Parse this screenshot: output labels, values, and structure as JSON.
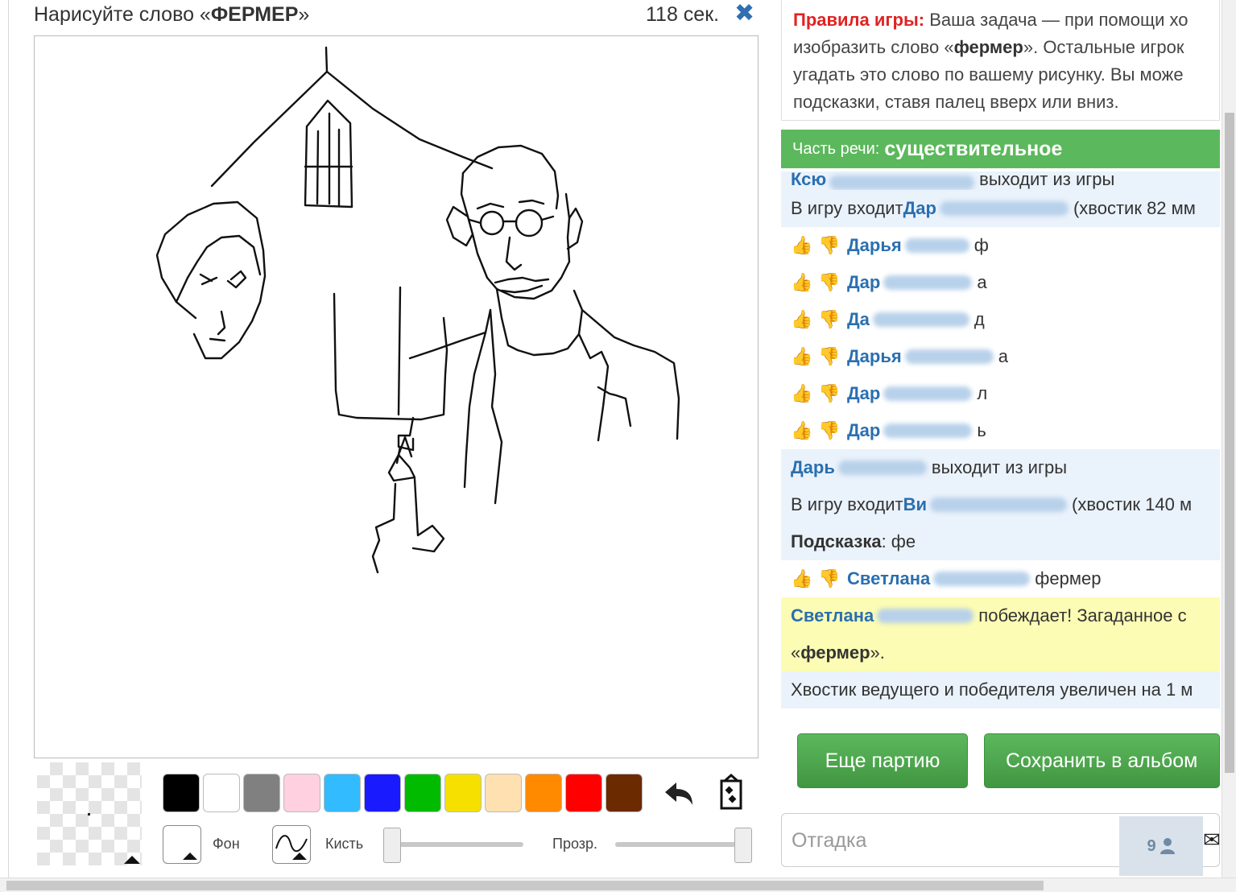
{
  "header": {
    "task_prefix": "Нарисуйте слово «",
    "task_word": "ФЕРМЕР",
    "task_suffix": "»",
    "timer": "118 сек.",
    "close_glyph": "✖"
  },
  "tools": {
    "palette": [
      "#000000",
      "#ffffff",
      "#808080",
      "#ffd0e0",
      "#33bbff",
      "#1a1aff",
      "#00bb00",
      "#f5e000",
      "#ffe0b0",
      "#ff8a00",
      "#ff0000",
      "#6b2a00"
    ],
    "background_label": "Фон",
    "brush_label": "Кисть",
    "opacity_label": "Прозр.",
    "undo_icon": "undo-icon",
    "clear_icon": "clear-canvas-icon"
  },
  "rules": {
    "title": "Правила игры:",
    "line1": " Ваша задача — при помощи хо",
    "line2_pre": "изобразить слово «",
    "line2_word": "фермер",
    "line2_post": "». Остальные игрок",
    "line3": "угадать это слово по вашему рисунку. Вы може",
    "line4": "подсказки, ставя палец вверх или вниз."
  },
  "part_of_speech": {
    "label": "Часть речи:",
    "value": "существительное"
  },
  "chat": {
    "row0_name": "Ксю",
    "row0_text": "выходит из игры",
    "row1_pre": "В игру входит ",
    "row1_name": "Дар",
    "row1_post": "(хвостик 82 мм",
    "guesses": [
      {
        "name": "Дарья",
        "text": "ф"
      },
      {
        "name": "Дар",
        "text": "а"
      },
      {
        "name": "Да",
        "text": "д"
      },
      {
        "name": "Дарья",
        "text": "а"
      },
      {
        "name": "Дар",
        "text": "л"
      },
      {
        "name": "Дар",
        "text": "ь"
      }
    ],
    "leave_name": "Дарь",
    "leave_text": "выходит из игры",
    "join2_pre": "В игру входит ",
    "join2_name": "Ви",
    "join2_post": "(хвостик 140 м",
    "hint_label": "Подсказка",
    "hint_text": ": фе",
    "final_guess_name": "Светлана",
    "final_guess_text": "фермер",
    "winner_name": "Светлана",
    "winner_text": "побеждает! Загаданное с",
    "winner_word_pre": "«",
    "winner_word": "фермер",
    "winner_word_post": "».",
    "bonus_text": "Хвостик ведущего и победителя увеличен на 1 м"
  },
  "buttons": {
    "another_game": "Еще партию",
    "save_album": "Сохранить в альбом"
  },
  "guess": {
    "placeholder": "Отгадка",
    "players_count": "9"
  }
}
